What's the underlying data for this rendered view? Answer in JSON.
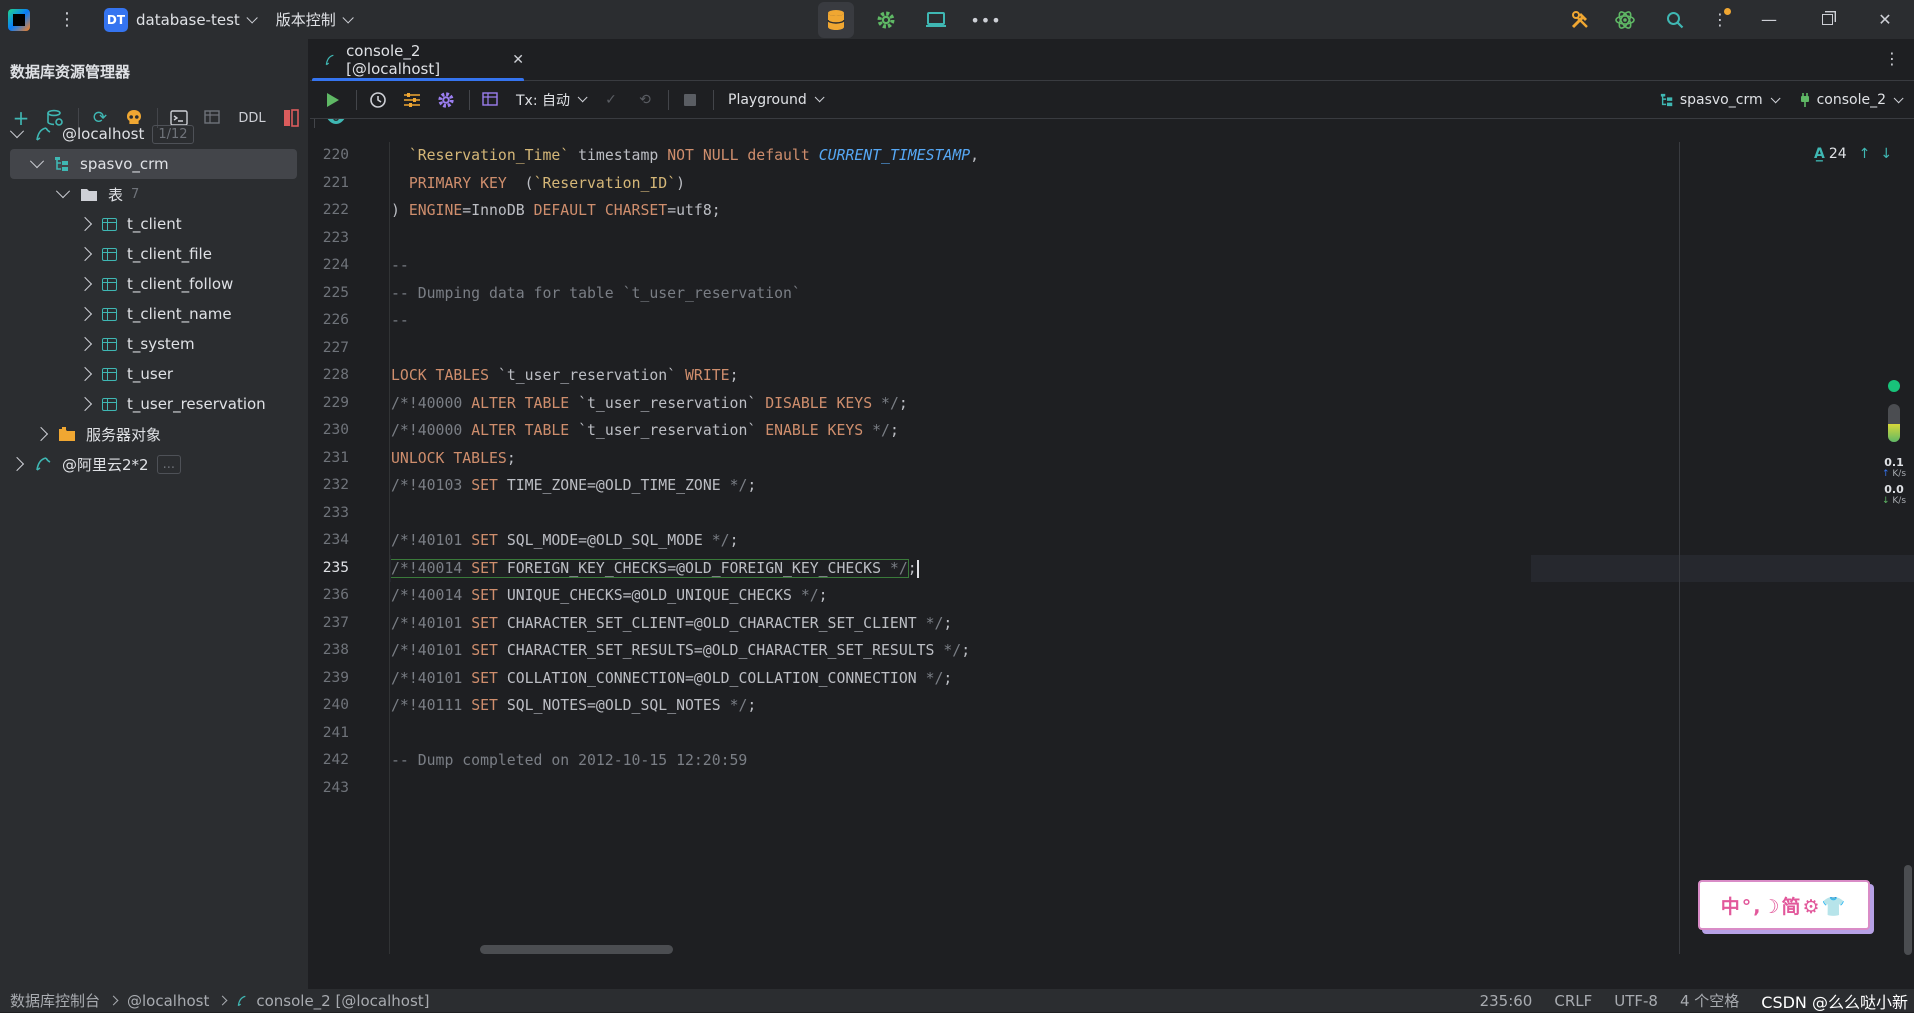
{
  "window": {
    "project_badge": "DT",
    "project_name": "database-test",
    "vcs_label": "版本控制"
  },
  "sidebar": {
    "title": "数据库资源管理器",
    "toolbar": {
      "ddl_label": "DDL"
    },
    "tree": {
      "host": {
        "label": "@localhost",
        "count": "1/12"
      },
      "schema": {
        "label": "spasvo_crm"
      },
      "tables_folder": {
        "label": "表",
        "count": "7"
      },
      "tables": [
        {
          "label": "t_client"
        },
        {
          "label": "t_client_file"
        },
        {
          "label": "t_client_follow"
        },
        {
          "label": "t_client_name"
        },
        {
          "label": "t_system"
        },
        {
          "label": "t_user"
        },
        {
          "label": "t_user_reservation"
        }
      ],
      "server_objects": {
        "label": "服务器对象"
      },
      "remote_host": {
        "label": "@阿里云2*2",
        "count": "..."
      }
    }
  },
  "editor": {
    "tab": {
      "label": "console_2 [@localhost]"
    },
    "toolbar": {
      "tx_label": "Tx: 自动",
      "mode_label": "Playground",
      "schema_selector": "spasvo_crm",
      "session_selector": "console_2"
    },
    "inspection_count": "24",
    "current_line": "235",
    "line_numbers": [
      "220",
      "221",
      "222",
      "223",
      "224",
      "225",
      "226",
      "227",
      "228",
      "229",
      "230",
      "231",
      "232",
      "233",
      "234",
      "235",
      "236",
      "237",
      "238",
      "239",
      "240",
      "241",
      "242",
      "243"
    ]
  },
  "network_monitor": {
    "up": "0.1",
    "up_unit": "K/s",
    "down": "0.0",
    "down_unit": "K/s"
  },
  "ime_toolbar": {
    "text": "中°,☽简⚙👕"
  },
  "statusbar": {
    "crumbs": [
      "数据库控制台",
      "@localhost",
      "console_2 [@localhost]"
    ],
    "position": "235:60",
    "line_ending": "CRLF",
    "encoding": "UTF-8",
    "indent": "4 个空格",
    "watermark": "CSDN @么么哒小新"
  },
  "colors": {
    "accent": "#3574f0",
    "keyword": "#cf8e6d",
    "string": "#d5b778",
    "comment": "#7a7e85",
    "function": "#56a8f5"
  }
}
